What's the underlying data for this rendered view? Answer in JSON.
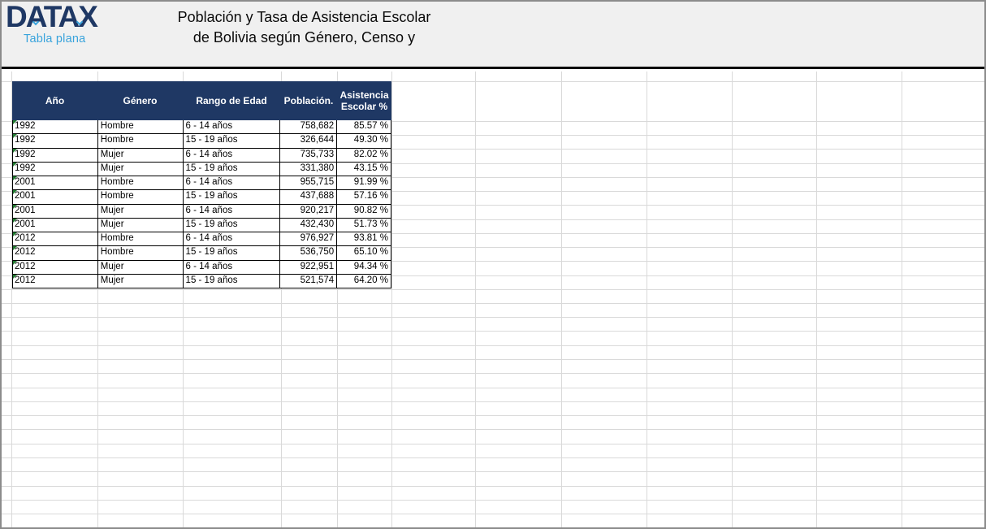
{
  "banner": {
    "logo_text": "DATAX",
    "logo_tagline": "Tabla plana",
    "title_line1": "Población y Tasa de Asistencia Escolar",
    "title_line2": "de Bolivia según Género, Censo y"
  },
  "colors": {
    "logo_navy": "#1F3864",
    "tagline_blue": "#38A3DC",
    "banner_background": "#F0F0F0",
    "table_header_navy": "#1F3864",
    "table_header_text": "#FFFFFF",
    "gridline_gray": "#D9D9D9",
    "divider_black": "#000000",
    "error_indicator_green": "#1E7A2E"
  },
  "table": {
    "headers": [
      "Año",
      "Género",
      "Rango de Edad",
      "Población.",
      "Asistencia Escolar %"
    ],
    "rows": [
      {
        "year": "1992",
        "gender": "Hombre",
        "age_range": "6 - 14 años",
        "population": "758,682",
        "attendance": "85.57 %"
      },
      {
        "year": "1992",
        "gender": "Hombre",
        "age_range": "15 - 19 años",
        "population": "326,644",
        "attendance": "49.30 %"
      },
      {
        "year": "1992",
        "gender": "Mujer",
        "age_range": "6 - 14 años",
        "population": "735,733",
        "attendance": "82.02 %"
      },
      {
        "year": "1992",
        "gender": "Mujer",
        "age_range": "15 - 19 años",
        "population": "331,380",
        "attendance": "43.15 %"
      },
      {
        "year": "2001",
        "gender": "Hombre",
        "age_range": "6 - 14 años",
        "population": "955,715",
        "attendance": "91.99 %"
      },
      {
        "year": "2001",
        "gender": "Hombre",
        "age_range": "15 - 19 años",
        "population": "437,688",
        "attendance": "57.16 %"
      },
      {
        "year": "2001",
        "gender": "Mujer",
        "age_range": "6 - 14 años",
        "population": "920,217",
        "attendance": "90.82 %"
      },
      {
        "year": "2001",
        "gender": "Mujer",
        "age_range": "15 - 19 años",
        "population": "432,430",
        "attendance": "51.73 %"
      },
      {
        "year": "2012",
        "gender": "Hombre",
        "age_range": "6 - 14 años",
        "population": "976,927",
        "attendance": "93.81 %"
      },
      {
        "year": "2012",
        "gender": "Hombre",
        "age_range": "15 - 19 años",
        "population": "536,750",
        "attendance": "65.10 %"
      },
      {
        "year": "2012",
        "gender": "Mujer",
        "age_range": "6 - 14 años",
        "population": "922,951",
        "attendance": "94.34 %"
      },
      {
        "year": "2012",
        "gender": "Mujer",
        "age_range": "15 - 19 años",
        "population": "521,574",
        "attendance": "64.20 %"
      }
    ]
  }
}
